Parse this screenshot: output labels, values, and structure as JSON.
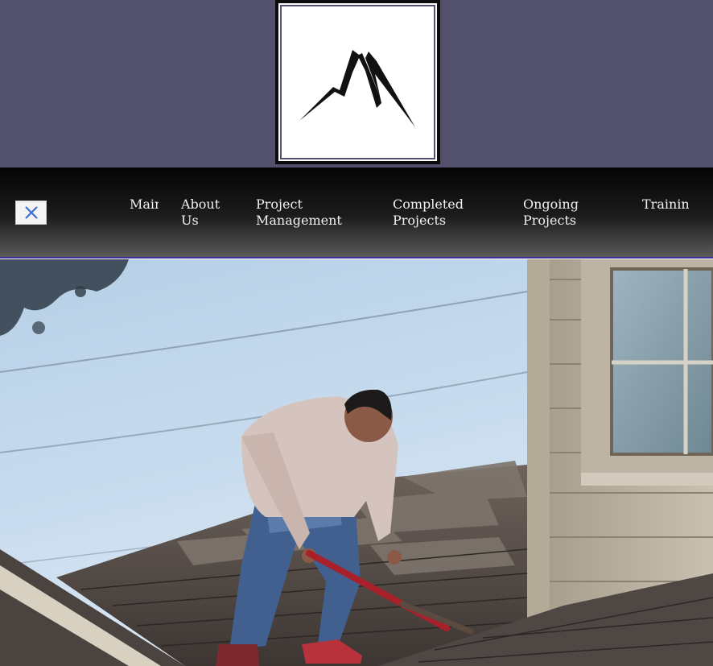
{
  "header": {
    "logo_icon": "mountain-logo-icon",
    "background_color": "#52506c"
  },
  "nav": {
    "close_icon": "close-icon",
    "accent_color": "#3a2fa0",
    "items": [
      {
        "label": "Main"
      },
      {
        "label": "About Us"
      },
      {
        "label": "Project Management"
      },
      {
        "label": "Completed Projects"
      },
      {
        "label": "Ongoing Projects"
      },
      {
        "label": "Training"
      }
    ]
  },
  "hero": {
    "image_subject": "roofer-removing-shingles-photo"
  }
}
